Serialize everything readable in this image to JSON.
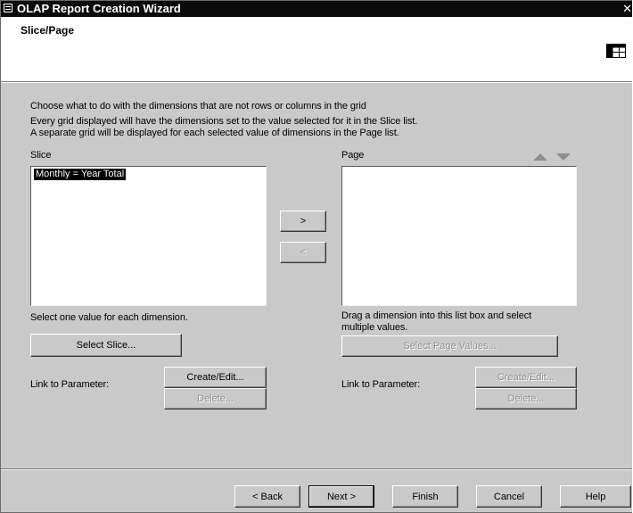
{
  "window": {
    "title": "OLAP Report Creation Wizard",
    "close_glyph": "✕"
  },
  "header": {
    "title": "Slice/Page",
    "icon": "grid-table-icon"
  },
  "instructions": {
    "line1": "Choose what to do with the dimensions that are not rows or columns in the grid",
    "line2": "Every grid displayed will have the dimensions set to the value selected for it in the Slice list.",
    "line3": "A separate grid will be displayed for each selected value of dimensions in the Page list."
  },
  "slice": {
    "label": "Slice",
    "items": [
      "Monthly = Year Total"
    ],
    "hint": "Select one value for each dimension.",
    "select_button": "Select Slice...",
    "link_label": "Link to Parameter:",
    "create_button": "Create/Edit...",
    "delete_button": "Delete..."
  },
  "page": {
    "label": "Page",
    "items": [],
    "hint_line1": "Drag a dimension into this list box and select",
    "hint_line2": "multiple values.",
    "select_button": "Select Page Values...",
    "link_label": "Link to Parameter:",
    "create_button": "Create/Edit...",
    "delete_button": "Delete...",
    "move_up_icon": "triangle-up-icon",
    "move_down_icon": "triangle-down-icon"
  },
  "move_buttons": {
    "right": ">",
    "left": "<"
  },
  "footer": {
    "back": "< Back",
    "next": "Next >",
    "finish": "Finish",
    "cancel": "Cancel",
    "help": "Help"
  }
}
